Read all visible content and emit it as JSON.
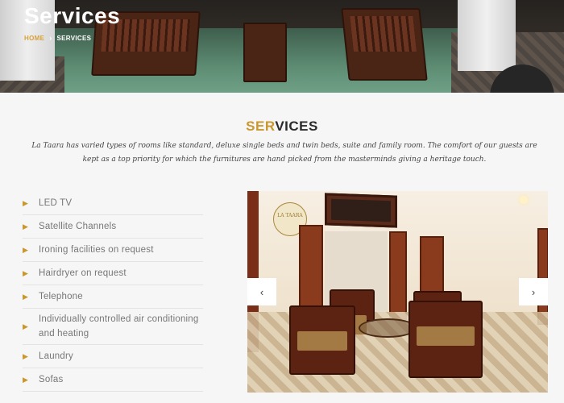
{
  "hero": {
    "title": "Services",
    "breadcrumb": {
      "home": "HOME",
      "separator": "›",
      "current": "SERVICES"
    }
  },
  "section": {
    "title_accent": "SER",
    "title_rest": "VICES",
    "intro": "La Taara has varied types of rooms like standard, deluxe single beds and twin beds, suite and family room. The comfort of our guests are kept as a top priority for which the furnitures are hand picked from the masterminds giving a heritage touch."
  },
  "amenities": [
    "LED TV",
    "Satellite Channels",
    "Ironing facilities on request",
    "Hairdryer on request",
    "Telephone",
    "Individually controlled air conditioning and heating",
    "Laundry",
    "Sofas"
  ],
  "slider": {
    "logo_text": "LA TAARA",
    "prev_icon": "‹",
    "next_icon": "›"
  },
  "colors": {
    "accent": "#c9972e",
    "text_muted": "#777777"
  }
}
